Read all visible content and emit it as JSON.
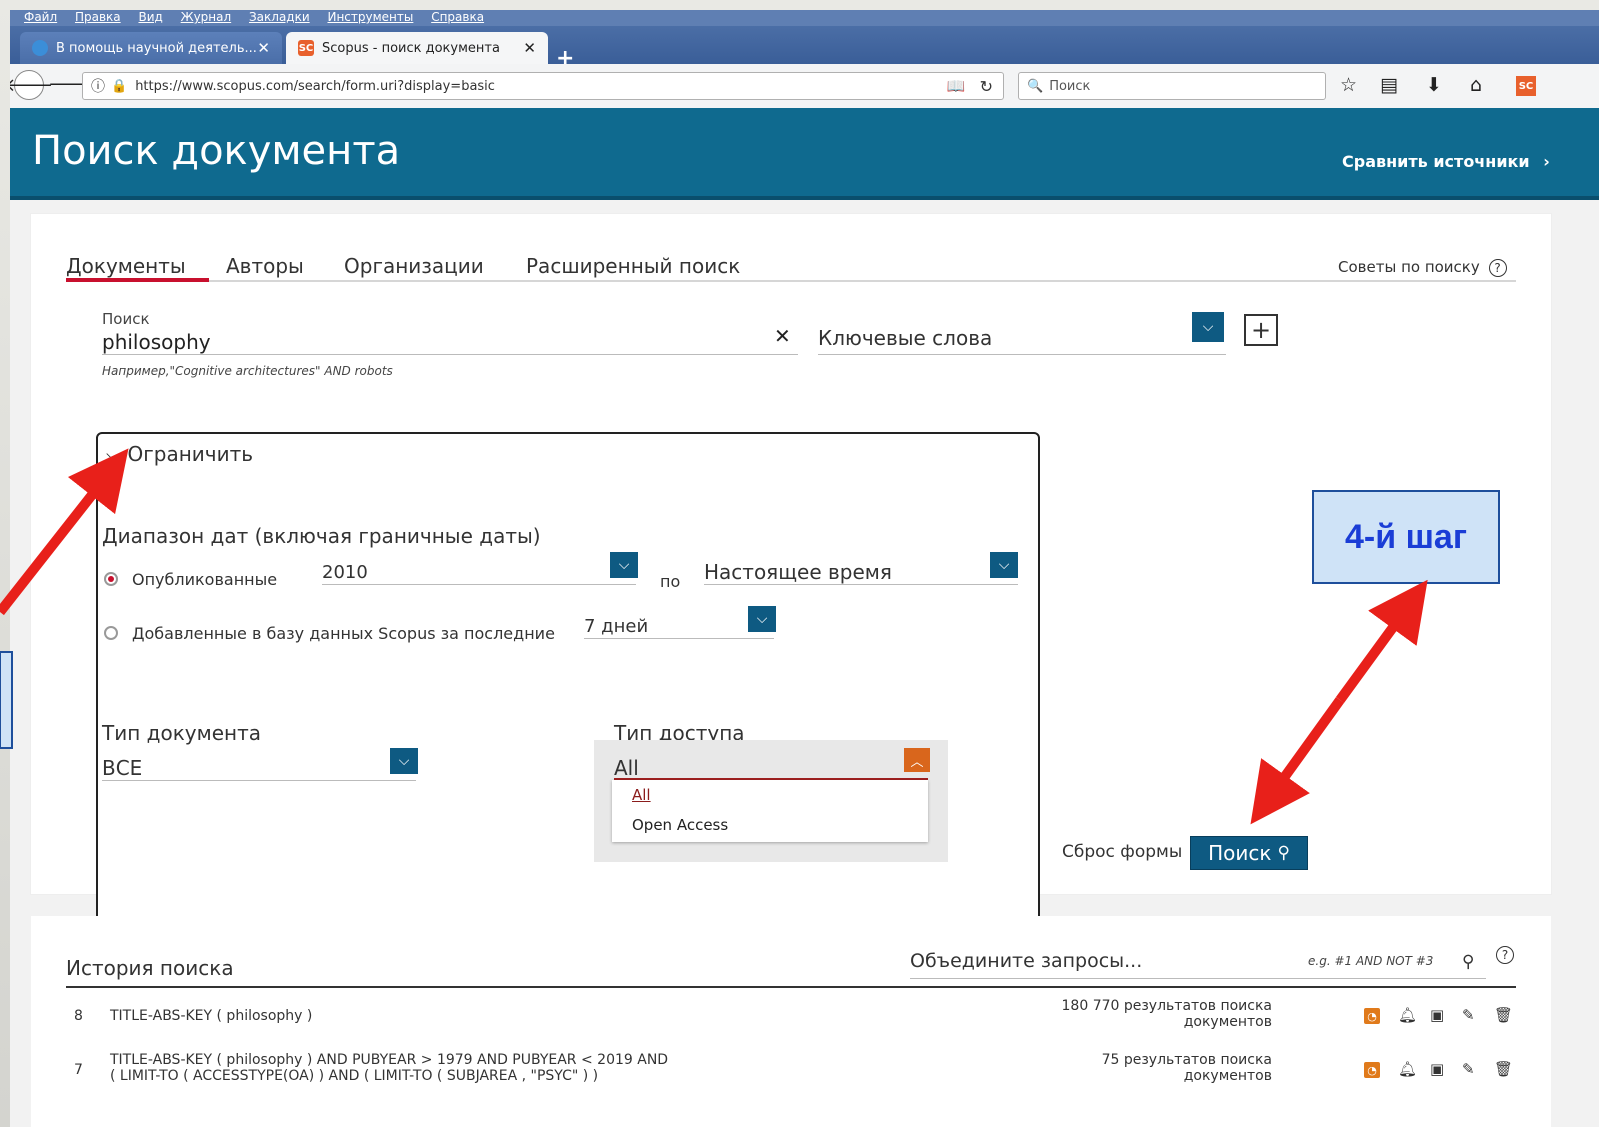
{
  "browser": {
    "menu": [
      "Файл",
      "Правка",
      "Вид",
      "Журнал",
      "Закладки",
      "Инструменты",
      "Справка"
    ],
    "tabs": [
      {
        "label": "В помощь научной деятель...",
        "active": false
      },
      {
        "label": "Scopus - поиск документа",
        "active": true
      }
    ],
    "url": "https://www.scopus.com/search/form.uri?display=basic",
    "search_placeholder": "Поиск",
    "favicon_sc": "SC"
  },
  "header": {
    "title": "Поиск документа",
    "compare_link": "Сравнить источники"
  },
  "nav_tabs": [
    "Документы",
    "Авторы",
    "Организации",
    "Расширенный поиск"
  ],
  "search_tips": "Советы по поиску",
  "search": {
    "label": "Поиск",
    "value": "philosophy",
    "hint": "Например,\"Cognitive architectures\" AND robots",
    "field": "Ключевые слова"
  },
  "limit": {
    "toggle": "Ограничить",
    "date_range_title": "Диапазон дат (включая граничные даты)",
    "published_label": "Опубликованные",
    "from_year": "2010",
    "to_word": "по",
    "to_value": "Настоящее время",
    "added_label": "Добавленные в базу данных Scopus за последние",
    "added_value": "7 дней",
    "doc_type_title": "Тип документа",
    "doc_type_value": "ВСЕ",
    "access_title": "Тип доступа",
    "access_value": "All",
    "access_options": [
      "All",
      "Open Access"
    ]
  },
  "actions": {
    "reset": "Сброс формы",
    "search_button": "Поиск"
  },
  "annotation": {
    "step": "4-й шаг"
  },
  "history": {
    "title": "История поиска",
    "combine_placeholder": "Объедините запросы...",
    "combine_hint": "e.g. #1 AND NOT #3",
    "rows": [
      {
        "num": "8",
        "query_line1": "TITLE-ABS-KEY ( philosophy )",
        "query_line2": "",
        "results_line1": "180 770 результатов поиска",
        "results_line2": "документов"
      },
      {
        "num": "7",
        "query_line1": "TITLE-ABS-KEY ( philosophy ) AND PUBYEAR > 1979 AND PUBYEAR < 2019 AND",
        "query_line2": "( LIMIT-TO ( ACCESSTYPE(OA) ) AND ( LIMIT-TO ( SUBJAREA , \"PSYC\" ) )",
        "results_line1": "75 результатов поиска",
        "results_line2": "документов"
      }
    ]
  },
  "colors": {
    "header_bg": "#0f6a8f",
    "button_bg": "#0e5a82",
    "accent_red": "#c8102e",
    "arrow_red": "#e8201a",
    "step_box_bg": "#cfe3f7",
    "step_text": "#1a3dd6"
  }
}
